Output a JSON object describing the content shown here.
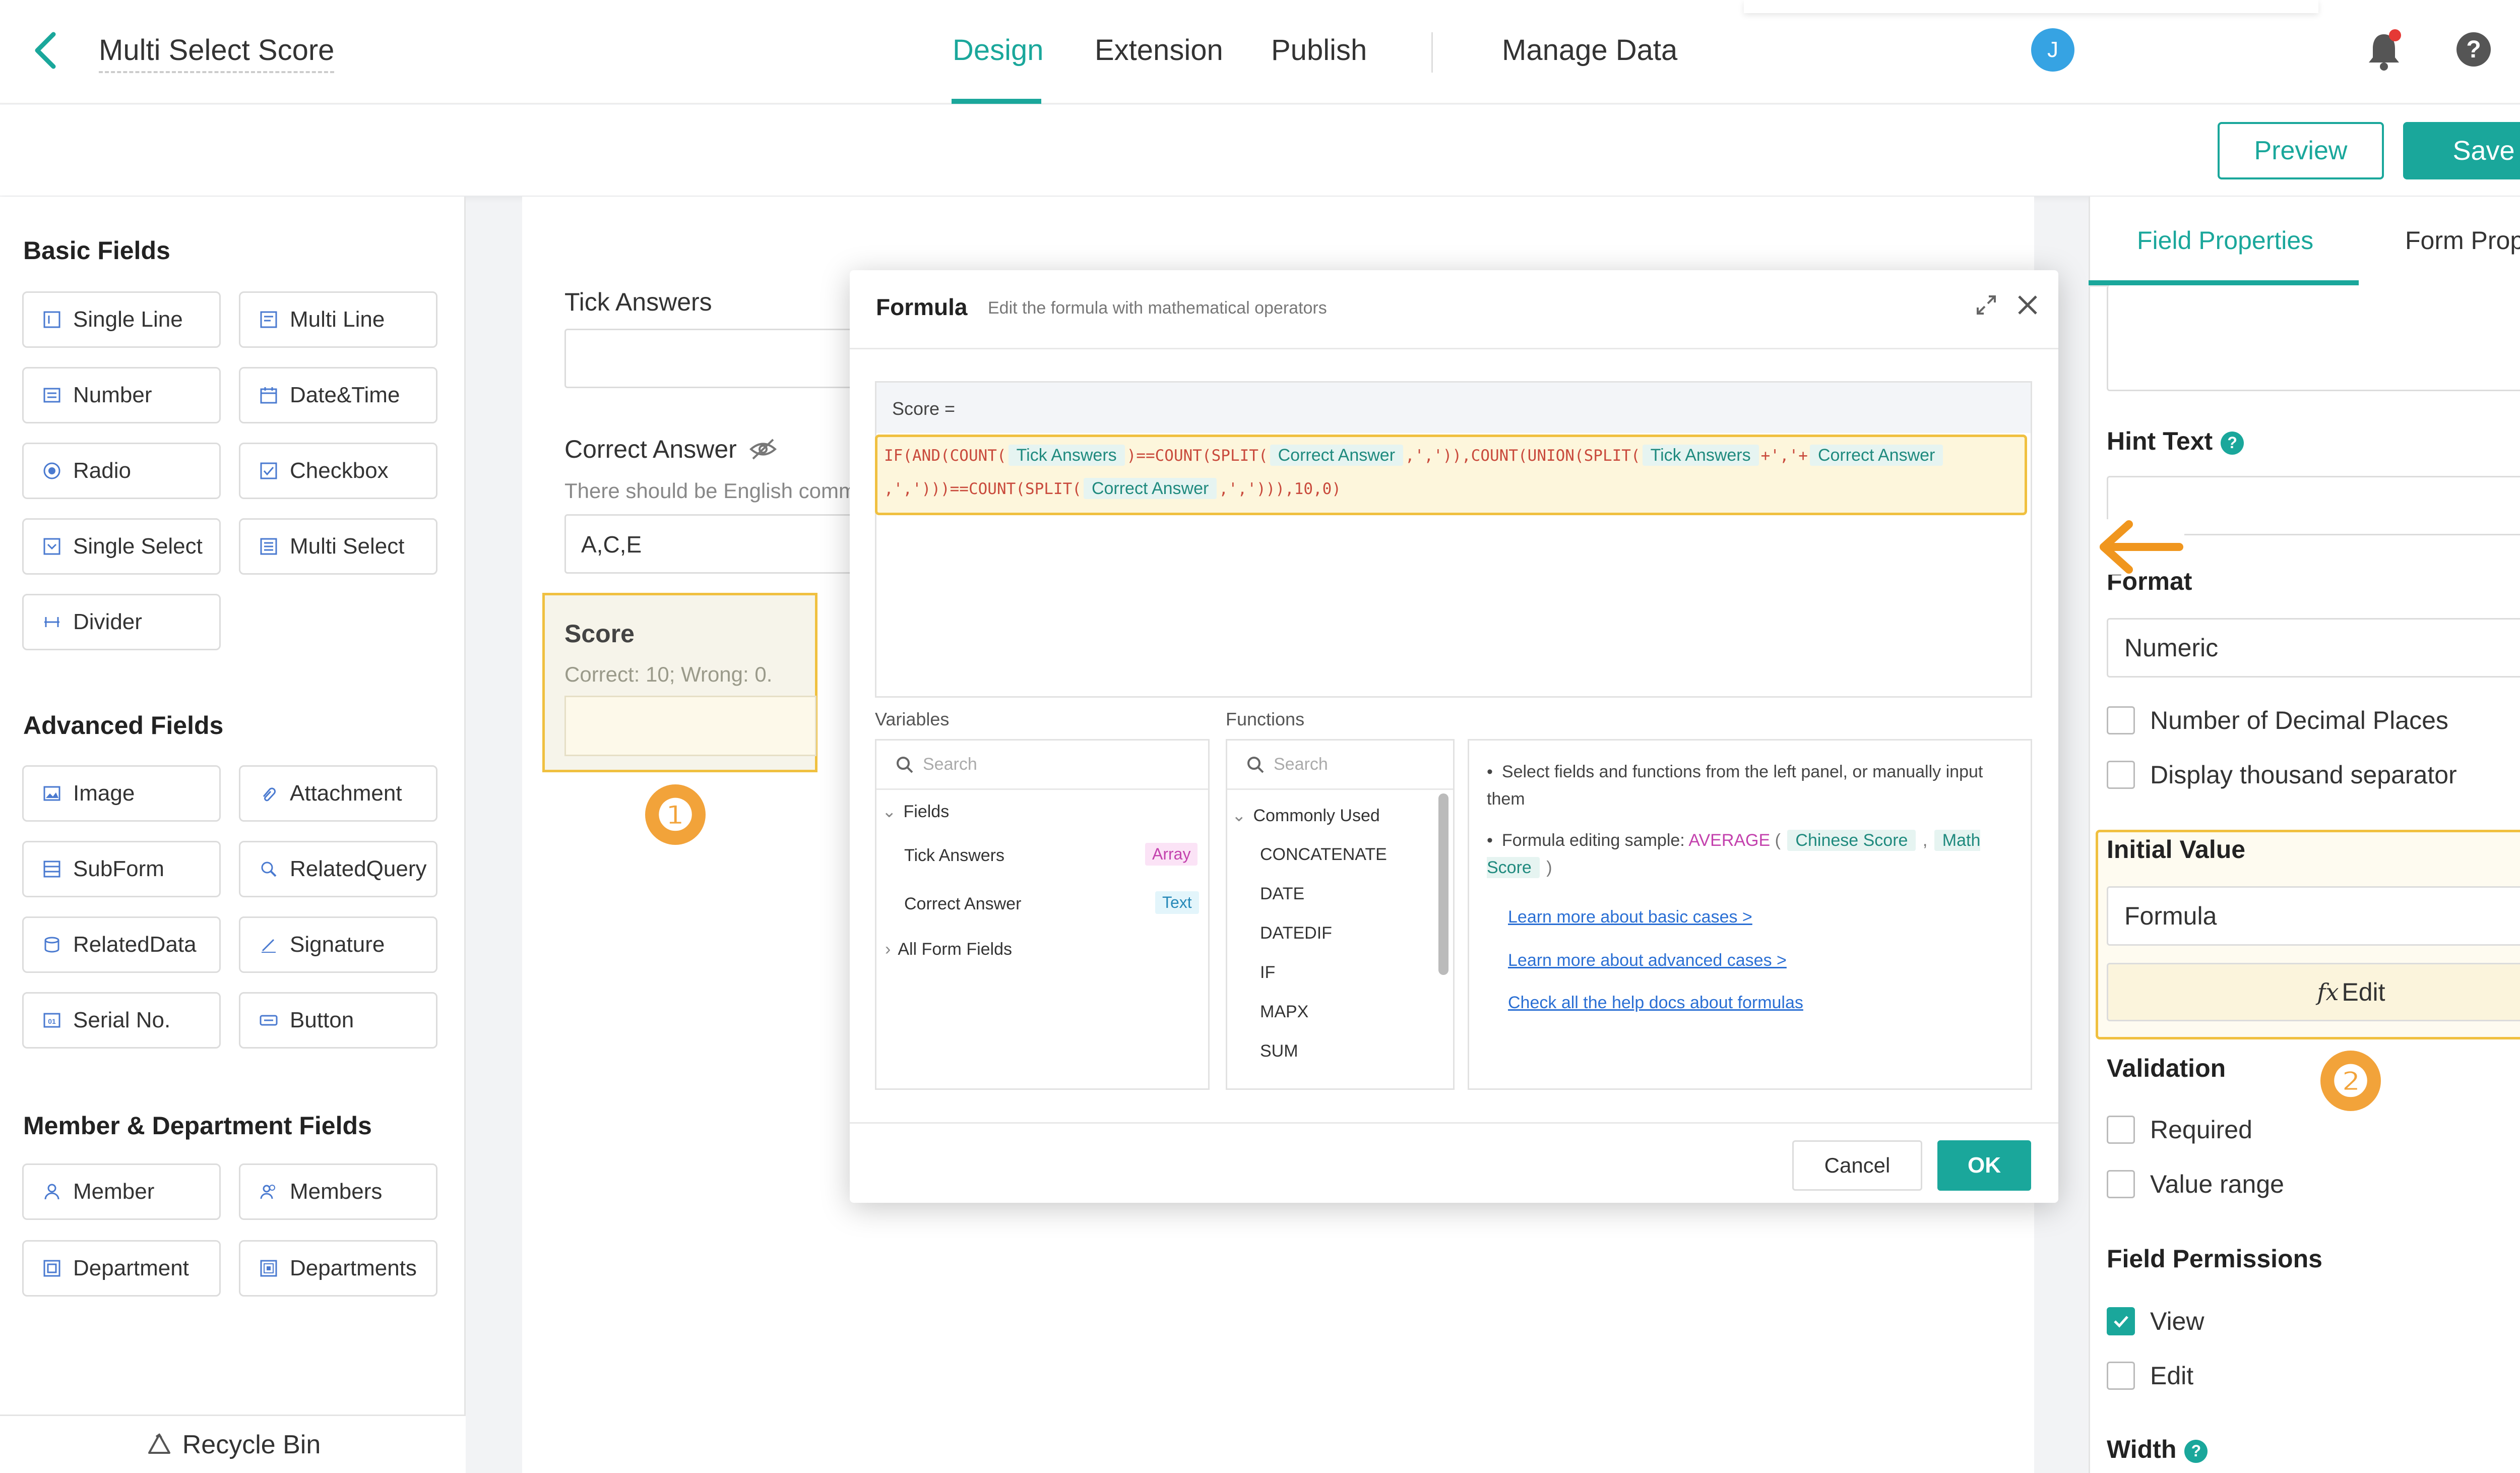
{
  "header": {
    "app_title": "Multi Select Score",
    "nav_tabs": [
      "Design",
      "Extension",
      "Publish",
      "Manage Data"
    ],
    "active_tab": "Design",
    "avatar_initial": "J",
    "accent_color": "#1aa79b"
  },
  "actions": {
    "preview_label": "Preview",
    "save_label": "Save"
  },
  "left_panel": {
    "basic_heading": "Basic Fields",
    "basic_fields": [
      "Single Line",
      "Multi Line",
      "Number",
      "Date&Time",
      "Radio",
      "Checkbox",
      "Single Select",
      "Multi Select",
      "Divider"
    ],
    "advanced_heading": "Advanced Fields",
    "advanced_fields": [
      "Image",
      "Attachment",
      "SubForm",
      "RelatedQuery",
      "RelatedData",
      "Signature",
      "Serial No.",
      "Button"
    ],
    "member_heading": "Member & Department Fields",
    "member_fields": [
      "Member",
      "Members",
      "Department",
      "Departments"
    ],
    "recycle_bin": "Recycle Bin"
  },
  "canvas": {
    "tick_answers_label": "Tick Answers",
    "correct_answer_label": "Correct Answer",
    "correct_answer_hint": "There should be English comm",
    "correct_answer_value": "A,C,E",
    "score_label": "Score",
    "score_desc": "Correct: 10; Wrong: 0.",
    "step1": "❶",
    "step2": "❷"
  },
  "formula_dialog": {
    "title": "Formula",
    "subtitle": "Edit the formula with mathematical operators",
    "field_label": "Score =",
    "formula_line1": {
      "p1": "IF(AND(COUNT(",
      "t1": "Tick Answers",
      "p2": ")==COUNT(SPLIT(",
      "t2": "Correct Answer",
      "p3": ",',')),COUNT(UNION(SPLIT(",
      "t3": "Tick Answers",
      "p4": "+','+",
      "t4": "Correct Answer"
    },
    "formula_line2": {
      "p1": ",',')))==COUNT(SPLIT(",
      "t1": "Correct Answer",
      "p2": ",','))),10,0)"
    },
    "variables_heading": "Variables",
    "functions_heading": "Functions",
    "var_search_placeholder": "Search",
    "fn_search_placeholder": "Search",
    "fields_group": "Fields",
    "variables": [
      {
        "name": "Tick Answers",
        "type": "Array"
      },
      {
        "name": "Correct Answer",
        "type": "Text"
      }
    ],
    "all_form_fields": "All Form Fields",
    "functions_group": "Commonly Used",
    "functions": [
      "CONCATENATE",
      "DATE",
      "DATEDIF",
      "IF",
      "MAPX",
      "SUM"
    ],
    "help_text_1": "Select fields and functions from the left panel, or manually input them",
    "help_sample_prefix": "Formula editing sample: ",
    "help_sample_fn": "AVERAGE",
    "help_sample_tag1": "Chinese Score",
    "help_sample_tag2": "Math Score",
    "link_basic": "Learn more about basic cases >",
    "link_advanced": "Learn more about advanced cases >",
    "link_docs": "Check all the help docs about formulas",
    "cancel_label": "Cancel",
    "ok_label": "OK"
  },
  "right_panel": {
    "tab_field": "Field Properties",
    "tab_form": "Form Properties",
    "hint_text_label": "Hint Text",
    "format_label": "Format",
    "format_value": "Numeric",
    "decimal_label": "Number of Decimal Places",
    "thousand_label": "Display thousand separator",
    "initial_value_label": "Initial Value",
    "initial_value_value": "Formula",
    "edit_label": "Edit",
    "edit_fx": "fx",
    "validation_label": "Validation",
    "required_label": "Required",
    "value_range_label": "Value range",
    "permissions_label": "Field Permissions",
    "view_label": "View",
    "edit_perm_label": "Edit",
    "width_label": "Width"
  }
}
